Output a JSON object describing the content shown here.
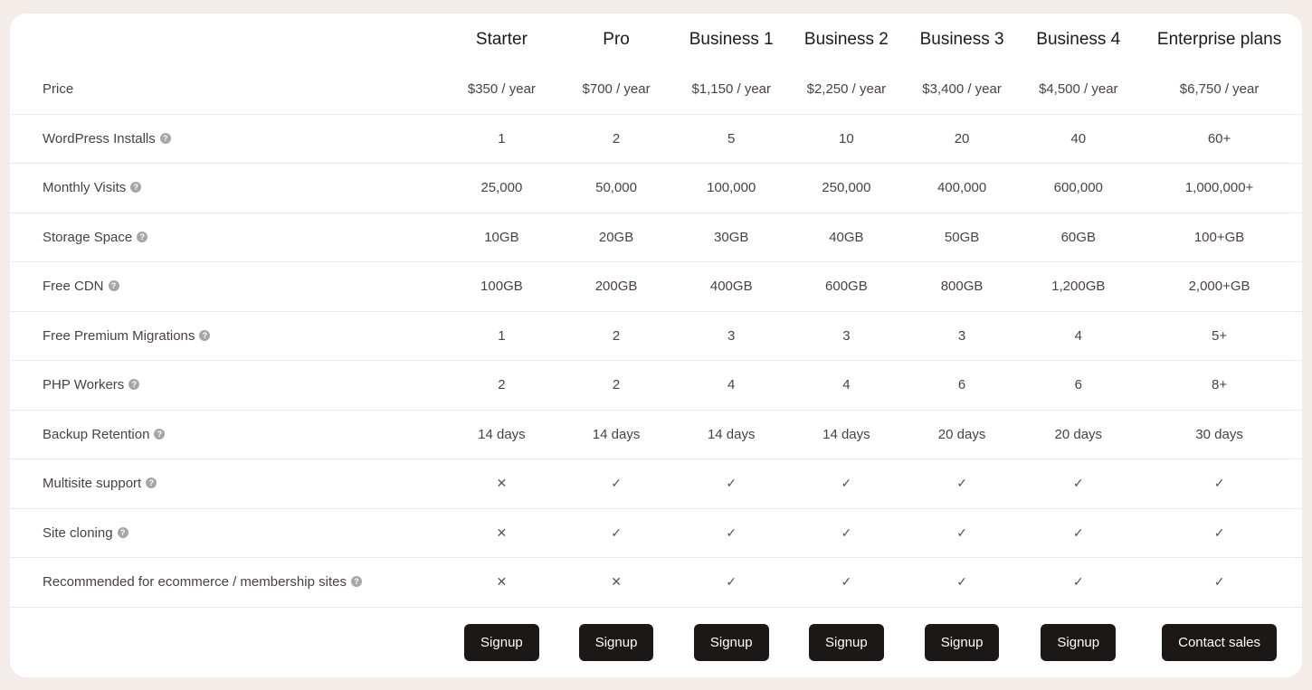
{
  "plans": [
    {
      "name": "Starter",
      "price": "$350 / year",
      "cta": "Signup"
    },
    {
      "name": "Pro",
      "price": "$700 / year",
      "cta": "Signup"
    },
    {
      "name": "Business 1",
      "price": "$1,150 / year",
      "cta": "Signup"
    },
    {
      "name": "Business 2",
      "price": "$2,250 / year",
      "cta": "Signup"
    },
    {
      "name": "Business 3",
      "price": "$3,400 / year",
      "cta": "Signup"
    },
    {
      "name": "Business 4",
      "price": "$4,500 / year",
      "cta": "Signup"
    },
    {
      "name": "Enterprise plans",
      "price": "$6,750 / year",
      "cta": "Contact sales"
    }
  ],
  "price_label": "Price",
  "help_icon": "question-circle-icon",
  "help_glyph": "?",
  "icons": {
    "yes": "✓",
    "no": "✕"
  },
  "features": [
    {
      "label": "WordPress Installs",
      "values": [
        "1",
        "2",
        "5",
        "10",
        "20",
        "40",
        "60+"
      ]
    },
    {
      "label": "Monthly Visits",
      "values": [
        "25,000",
        "50,000",
        "100,000",
        "250,000",
        "400,000",
        "600,000",
        "1,000,000+"
      ]
    },
    {
      "label": "Storage Space",
      "values": [
        "10GB",
        "20GB",
        "30GB",
        "40GB",
        "50GB",
        "60GB",
        "100+GB"
      ]
    },
    {
      "label": "Free CDN",
      "values": [
        "100GB",
        "200GB",
        "400GB",
        "600GB",
        "800GB",
        "1,200GB",
        "2,000+GB"
      ]
    },
    {
      "label": "Free Premium Migrations",
      "values": [
        "1",
        "2",
        "3",
        "3",
        "3",
        "4",
        "5+"
      ]
    },
    {
      "label": "PHP Workers",
      "values": [
        "2",
        "2",
        "4",
        "4",
        "6",
        "6",
        "8+"
      ]
    },
    {
      "label": "Backup Retention",
      "values": [
        "14 days",
        "14 days",
        "14 days",
        "14 days",
        "20 days",
        "20 days",
        "30 days"
      ]
    },
    {
      "label": "Multisite support",
      "values": [
        false,
        true,
        true,
        true,
        true,
        true,
        true
      ]
    },
    {
      "label": "Site cloning",
      "values": [
        false,
        true,
        true,
        true,
        true,
        true,
        true
      ]
    },
    {
      "label": "Recommended for ecommerce / membership sites",
      "values": [
        false,
        false,
        true,
        true,
        true,
        true,
        true
      ]
    }
  ],
  "colors": {
    "page_bg": "#f3ece8",
    "card_bg": "#ffffff",
    "button_bg": "#1c1818",
    "button_text": "#ffffff",
    "help_icon": "#a9a5a3",
    "divider": "#ebe8e6"
  }
}
